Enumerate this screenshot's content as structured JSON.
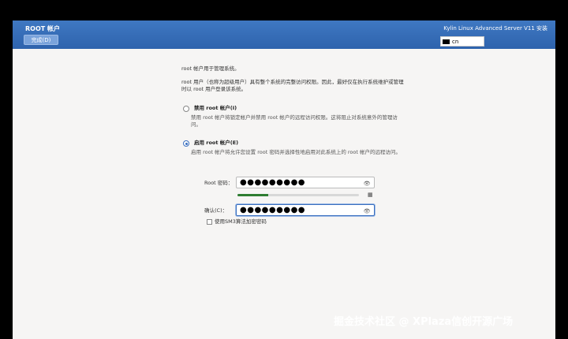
{
  "header": {
    "title": "ROOT 帐户",
    "done_button": "完成(D)",
    "product": "Kylin Linux Advanced Server V11 安装",
    "keyboard_layout": "cn"
  },
  "content": {
    "intro": "root 帐户用于管理系统。",
    "paragraph": "root 用户（也称为超级用户）具有整个系统的完整访问权限。因此，最好仅在执行系统维护或管理时以 root 用户登录该系统。",
    "disable_option": {
      "label": "禁用 root 帐户(I)",
      "description": "禁用 root 帐户将锁定帐户并禁用 root 帐户的远程访问权限。这将阻止对系统意外的管理访问。",
      "selected": false
    },
    "enable_option": {
      "label": "启用 root 帐户(E)",
      "description": "启用 root 帐户将允许您设置 root 密码并选择性地启用对此系统上的 root 帐户的远程访问。",
      "selected": true
    },
    "password": {
      "label": "Root 密码：",
      "value": "●●●●●●●●●",
      "strength": 0.25
    },
    "confirm": {
      "label": "确认(C)：",
      "value": "●●●●●●●●●"
    },
    "sm3_checkbox": {
      "label": "使用SM3算法加密密码",
      "checked": false
    }
  },
  "watermark": "掘金技术社区 @ XPlaza信创开源广场",
  "colors": {
    "header": "#3f78c2",
    "accent": "#3a6fbf",
    "strength": "#2e7d32"
  },
  "icons": [
    "eye-icon",
    "warning-icon",
    "keyboard-icon"
  ]
}
